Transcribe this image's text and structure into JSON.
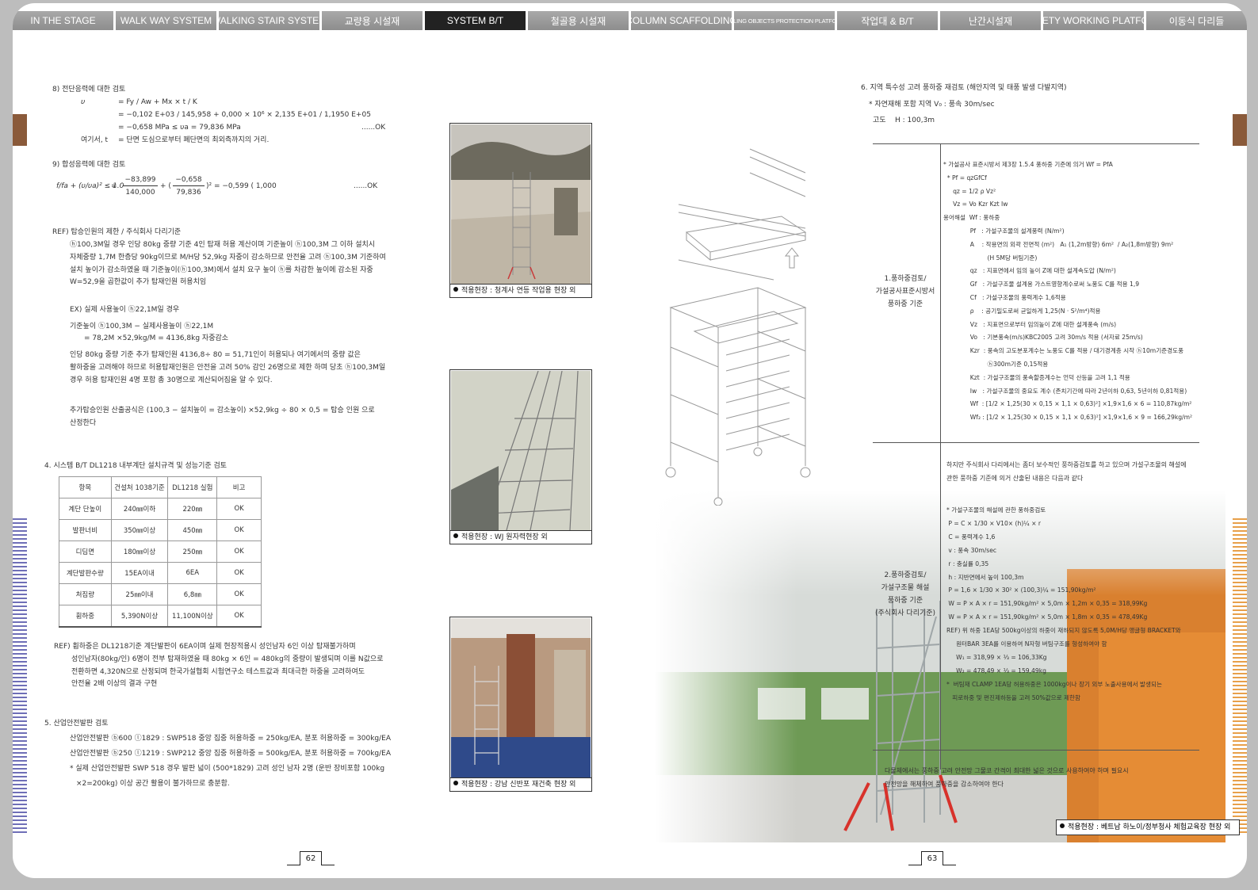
{
  "nav": {
    "tabs": [
      {
        "label": "IN THE STAGE",
        "active": false
      },
      {
        "label": "WALK WAY SYSTEM",
        "active": false
      },
      {
        "label": "WALKING STAIR SYSTEM",
        "active": false
      },
      {
        "label": "교량용 시설재",
        "active": false
      },
      {
        "label": "SYSTEM B/T",
        "active": true
      },
      {
        "label": "철골용 시설재",
        "active": false
      },
      {
        "label": "COLUMN SCAFFOLDING",
        "active": false
      },
      {
        "label": "FALLING OBJECTS PROTECTION PLATFORM",
        "active": false
      },
      {
        "label": "작업대 & B/T",
        "active": false
      },
      {
        "label": "난간시설재",
        "active": false
      },
      {
        "label": "SAFETY WORKING PLATFORM",
        "active": false
      },
      {
        "label": "이동식 다리들",
        "active": false
      }
    ]
  },
  "left": {
    "s8": {
      "heading": "8) 전단응력에 대한 검토",
      "sym": "υ",
      "l1": "= Fy / Aw + Mx × t / K",
      "l2": "= −0,102 E+03 / 145,958 + 0,000 × 10⁶ × 2,135 E+01 / 1,1950 E+05",
      "l3": "= −0,658 MPa ≤ υa = 79,836 MPa",
      "l3ok": "......OK",
      "where": "여기서, t",
      "where_def": "= 단면 도심으로부터 폐단면의 최외측까지의 거리."
    },
    "s9": {
      "heading": "9) 합성응력에 대한 검토",
      "formula": "f/fa + (υ/υa)² ≤ 1.0",
      "eq": "=",
      "num1": "−83,899",
      "den1": "140,000",
      "plus": "+ (",
      "num2": "−0,658",
      "den2": "79,836",
      "result": ")² = −0,599 ( 1,000",
      "ok": "......OK"
    },
    "ref1": {
      "heading": "REF) 탑승인원의 제한 / 주식회사 다리기준",
      "lines": [
        "ⓗ100,3M일 경우 인당 80kg 중량 기준 4인 탑재 허용 계산이며 기준높이 ⓗ100,3M 그 이하 설치시",
        "자체중량 1,7M 한층당 90kg이므로 M/H당 52,9kg 자중이 감소하므로 안전율 고려 ⓗ100,3M 기준하여",
        "설치 높이가 감소하였을 때 기준높이(ⓗ100,3M)에서 설치 요구 높이 ⓗ를 차감한 높이에 감소된 자중",
        "W=52,9을 곱한값이 추가 탑재인원 허용치임"
      ]
    },
    "ex": {
      "l1": "EX) 실제 사용높이 ⓗ22,1M일 경우",
      "l2": "기준높이 ⓗ100,3M − 실제사용높이 ⓗ22,1M",
      "l3": "= 78,2M ×52,9kg/M = 4136,8kg 자중감소",
      "lines": [
        "인당 80kg 중량 기준 추가 탑재인원 4136,8÷ 80 = 51,71인이 허용되나 여기에서의 중량 값은",
        "활하중을 고려해야 하므로 허용탑재인원은 안전을 고려 50% 감인 26명으로 제한 하며 당초 ⓗ100,3M일",
        "경우 허용 탑재인원 4명 포함 총 30명으로 계산되어짐을 알 수 있다."
      ]
    },
    "extra": {
      "lines": [
        "추가탑승인원 산출공식은 (100,3 − 설치높이 = 감소높이) ×52,9kg ÷ 80 × 0,5 = 탑승 인원 으로",
        "산정한다"
      ]
    },
    "s4": {
      "heading": "4. 시스템 B/T DL1218 내부계단 설치규격 및 성능기준 검토",
      "table": {
        "headers": [
          "항목",
          "건설처 1038기준",
          "DL1218 실험",
          "비고"
        ],
        "rows": [
          [
            "계단 단높이",
            "240㎜이하",
            "220㎜",
            "OK"
          ],
          [
            "발판너비",
            "350㎜이상",
            "450㎜",
            "OK"
          ],
          [
            "디딤면",
            "180㎜이상",
            "250㎜",
            "OK"
          ],
          [
            "계단발판수량",
            "15EA이내",
            "6EA",
            "OK"
          ],
          [
            "처짐량",
            "25㎜이내",
            "6,8㎜",
            "OK"
          ],
          [
            "휨하중",
            "5,390N이상",
            "11,100N이상",
            "OK"
          ]
        ]
      }
    },
    "ref2": {
      "lines": [
        "REF) 휨하중은 DL1218기준 계단발판이 6EA이며 실제 현장적용시 성인남자 6인 이상 탑재불가하며",
        "성인남자(80kg/인) 6명이 전부 탑재하였을 때 80kg × 6인 = 480kg의 중량이 발생되며 이를 N값으로",
        "전환하면 4,320N으로 산정되며 한국가설협회 시험연구소 테스트값과 최대극한 하중을 고려하여도",
        "안전율 2배 이상의 결과 구현"
      ]
    },
    "s5": {
      "heading": "5. 산업안전발판 검토",
      "lines": [
        "산업안전발판 ⓑ600 ⓛ1829 : SWP518 중앙 집중 허용하중 = 250kg/EA, 분포 허용하중 = 300kg/EA",
        "산업안전발판 ⓑ250 ⓛ1219 : SWP212 중앙 집중 허용하중 = 500kg/EA, 분포 허용하중 = 700kg/EA",
        "* 실제 산업안전발판 SWP 518 경우 발판 넓이 (500*1829) 고려 성인 남자 2명 (운반 장비포함 100kg",
        "×2=200kg) 이상 공간 활용이 불가하므로 충분함."
      ]
    },
    "photos": [
      {
        "caption": "적용현장 : 청계사 연등 작업용 현장 외"
      },
      {
        "caption": "적용현장 : WJ 원자력현장 외"
      },
      {
        "caption": "적용현장 :  강남 신반포 재건축 현장 외"
      }
    ],
    "page_number": "62"
  },
  "right": {
    "s6": {
      "heading": "6. 지역 특수성 고려 풍하중 재검토 (해안지역 및 태풍 발생 다발지역)",
      "sub": "* 자연재해 포함 지역 V₀ : 풍속 30m/sec",
      "alt": "고도    H : 100,3m"
    },
    "row1": {
      "label_lines": [
        "1.풍하중검토/",
        "가설공사표준시방서",
        "풍하중 기준"
      ],
      "lines": [
        "* 가설공사 표준시방서 제3장 1.5.4 풍하중 기준에 의거 Wf = PfA",
        "  * Pf = qzGfCf",
        "     qz = 1/2 ρ Vz²",
        "     Vz = Vo Kzr Kzt Iw",
        "용어해설  Wf : 풍하중",
        "              Pf   : 가설구조물의 설계풍력 (N/m²)",
        "              A    : 작용면의 외곽 전면적 (m²)   A₁ (1,2m방향) 6m²  / A₂(1,8m방향) 9m²",
        "                       (H 5M당 버팀기준)",
        "              qz   : 지표면에서 임의 높이 Z에 대한 설계속도압 (N/m²)",
        "              Gf   : 가설구조물 설계용 가스트영향계수로써 노풍도 C를 적용 1,9",
        "              Cf   : 가설구조물의 풍력계수 1,6적용",
        "              ρ    : 공기밀도로써 균일하게 1,25(N · S²/m⁴)적용",
        "              Vz   : 지표면으로부터 임의높이 Z에 대한 설계풍속 (m/s)",
        "              Vo   : 기본풍속(m/s)KBC2005 고려 30m/s 적용 (서자료 25m/s)",
        "              Kzr  : 풍속의 고도분포계수는 노풍도 C를 적용 / 대기경계층 시작 ⓗ10m기준경도풍",
        "                       ⓗ300m기준 0,15적용",
        "              Kzt  : 가설구조물의 풍속할증계수는 언덕 산등을 고려 1,1 적용",
        "              Iw   : 가설구조물의 중요도 계수 (존치기간에 따라 2년이하 0,63, 5년이하 0,81적용)",
        "              Wf  : [1/2 × 1,25(30 × 0,15 × 1,1 × 0,63)²] ×1,9×1,6 × 6 = 110,87kg/m²",
        "              Wf₂ : [1/2 × 1,25(30 × 0,15 × 1,1 × 0,63)²] ×1,9×1,6 × 9 = 166,29kg/m²"
      ]
    },
    "mid": {
      "lines": [
        "하지만 주식회사 다리에서는 좀더 보수적인 풍하중검토를 하고 있으며 가설구조물의 해설에",
        "관한 풍하중 기준에 의거 산출된 내용은 다음과 같다"
      ]
    },
    "row2": {
      "label_lines": [
        "2.풍하중검토/",
        "가설구조물 해설",
        "풍하중 기준",
        "(주식회사 다리기준)"
      ],
      "lines": [
        "* 가설구조물의 해설에 관한 풍하중검토",
        " P = C × 1/30 × V10× (h)¼ × r",
        " C = 풍력계수 1,6",
        " v : 풍속 30m/sec",
        " r : 충실률 0,35",
        " h : 지반면에서 높이 100,3m",
        " P = 1,6 × 1/30 × 30² × (100,3)¼ = 151,90kg/m²",
        " W = P × A × r = 151,90kg/m² × 5,0m × 1,2m × 0,35 = 318,99Kg",
        " W = P × A × r = 151,90kg/m² × 5,0m × 1,8m × 0,35 = 478,49Kg",
        "REF) 위 하중 1EA당 500kg이상의 하중이 재하되지 않도록 5,0M/H당 앵글형 BRACKET와",
        "     원터BAR 3EA를 이용하여 N자형 버팀구조를 형성하여야 함",
        "     W₁ = 318,99 × ⅓ = 106,33Kg",
        "     W₂ = 478,49 × ⅓ = 159,49kg",
        "*  버팀재 CLAMP 1EA당 허용하중은 1000kg이나 장기 외부 노출사용에서 발생되는",
        "   피로하중 및 편진제하등을 고려 50%값으로 제한함"
      ]
    },
    "bottom": {
      "lines": [
        "다물체에서는 풍하중 고려 안전망 그물코 간격이 최대한 넓은 것으로 사용하여야 하며 필요시",
        "안전망을 해체하여 풍하중을 감소하여야 한다"
      ]
    },
    "photo_caption": "적용현장 : 베트남 하노이/정부청사 체험교육장 현장 외",
    "page_number": "63"
  },
  "colors": {
    "nav_bg": "#9a9a9a",
    "nav_active": "#222222",
    "stripe_left": "#6f6fb7",
    "stripe_right": "#e8a04a",
    "crane_orange": "#e07a2a"
  }
}
